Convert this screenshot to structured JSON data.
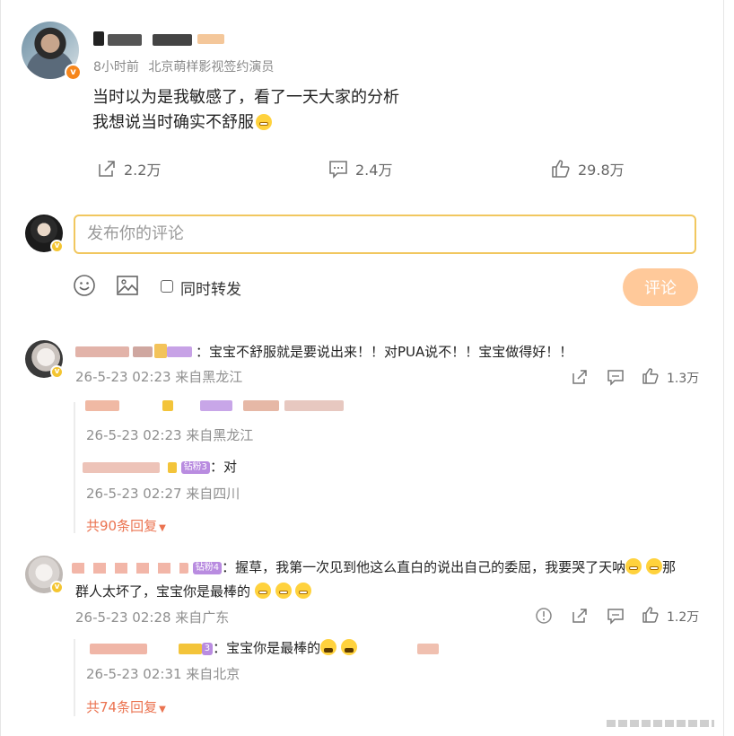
{
  "post": {
    "user_name": "",
    "time": "8小时前",
    "source": "北京萌样影视签约演员",
    "lines": [
      "当时以为是我敏感了，看了一天大家的分析",
      "我想说当时确实不舒服"
    ],
    "actions": {
      "repost_count": "2.2万",
      "comment_count": "2.4万",
      "like_count": "29.8万"
    }
  },
  "composer": {
    "placeholder": "发布你的评论",
    "repost_label": "同时转发",
    "submit_label": "评论"
  },
  "comments": [
    {
      "text": "：宝宝不舒服就是要说出来！！对PUA说不！！宝宝做得好！！",
      "time": "26-5-23 02:23 来自黑龙江",
      "like_count": "1.3万",
      "replies": [
        {
          "time": "26-5-23 02:23 来自黑龙江",
          "text": ""
        },
        {
          "badge": "钻粉3",
          "text": "：对",
          "time": "26-5-23 02:27 来自四川"
        }
      ],
      "more": "共90条回复"
    },
    {
      "badge": "钻粉4",
      "text_line1": "：握草，我第一次见到他这么直白的说出自己的委屈，我要哭了天呐",
      "text_line2_a": "那",
      "text_line2": "群人太坏了，宝宝你是最棒的",
      "time": "26-5-23 02:28 来自广东",
      "like_count": "1.2万",
      "replies": [
        {
          "badge": "3",
          "text": "：宝宝你是最棒的",
          "time": "26-5-23 02:31 来自北京"
        }
      ],
      "more": "共74条回复"
    }
  ],
  "colors": {
    "accent": "#eb7350",
    "input_border": "#f1c75f",
    "submit_bg": "#ffc99a"
  }
}
